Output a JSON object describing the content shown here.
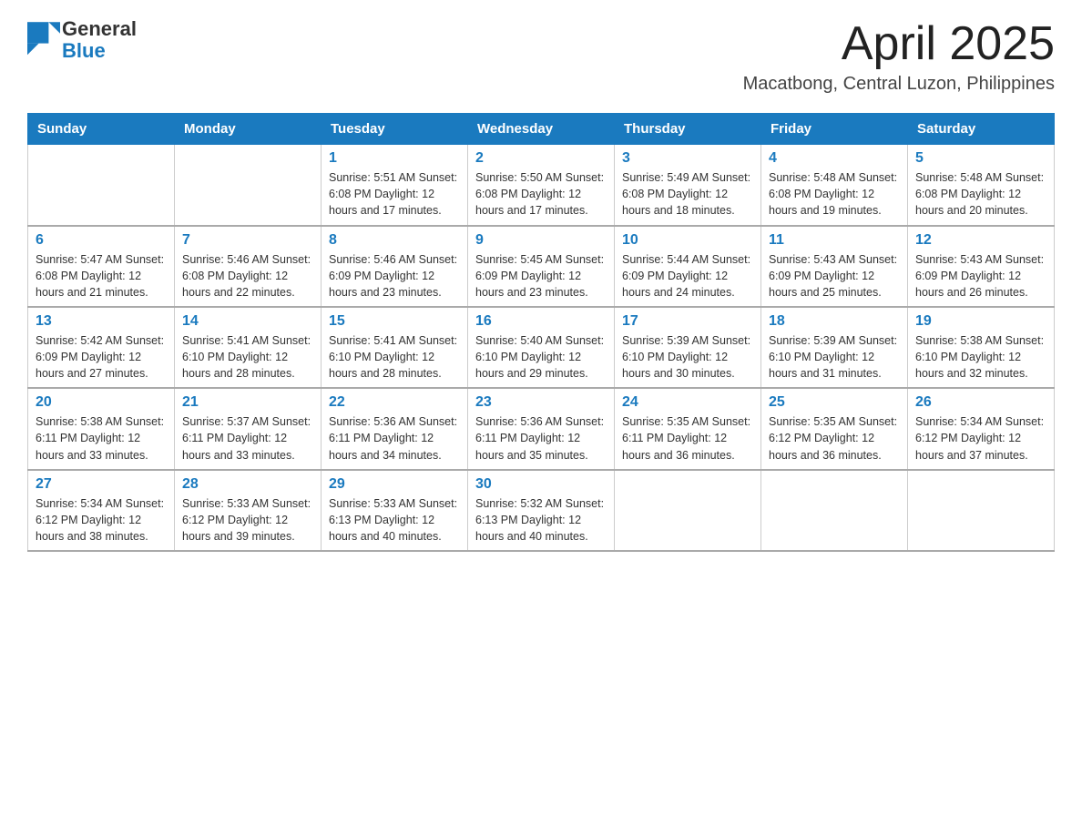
{
  "header": {
    "logo_text_general": "General",
    "logo_text_blue": "Blue",
    "month_title": "April 2025",
    "location": "Macatbong, Central Luzon, Philippines"
  },
  "calendar": {
    "days_of_week": [
      "Sunday",
      "Monday",
      "Tuesday",
      "Wednesday",
      "Thursday",
      "Friday",
      "Saturday"
    ],
    "weeks": [
      [
        {
          "day": "",
          "info": ""
        },
        {
          "day": "",
          "info": ""
        },
        {
          "day": "1",
          "info": "Sunrise: 5:51 AM\nSunset: 6:08 PM\nDaylight: 12 hours\nand 17 minutes."
        },
        {
          "day": "2",
          "info": "Sunrise: 5:50 AM\nSunset: 6:08 PM\nDaylight: 12 hours\nand 17 minutes."
        },
        {
          "day": "3",
          "info": "Sunrise: 5:49 AM\nSunset: 6:08 PM\nDaylight: 12 hours\nand 18 minutes."
        },
        {
          "day": "4",
          "info": "Sunrise: 5:48 AM\nSunset: 6:08 PM\nDaylight: 12 hours\nand 19 minutes."
        },
        {
          "day": "5",
          "info": "Sunrise: 5:48 AM\nSunset: 6:08 PM\nDaylight: 12 hours\nand 20 minutes."
        }
      ],
      [
        {
          "day": "6",
          "info": "Sunrise: 5:47 AM\nSunset: 6:08 PM\nDaylight: 12 hours\nand 21 minutes."
        },
        {
          "day": "7",
          "info": "Sunrise: 5:46 AM\nSunset: 6:08 PM\nDaylight: 12 hours\nand 22 minutes."
        },
        {
          "day": "8",
          "info": "Sunrise: 5:46 AM\nSunset: 6:09 PM\nDaylight: 12 hours\nand 23 minutes."
        },
        {
          "day": "9",
          "info": "Sunrise: 5:45 AM\nSunset: 6:09 PM\nDaylight: 12 hours\nand 23 minutes."
        },
        {
          "day": "10",
          "info": "Sunrise: 5:44 AM\nSunset: 6:09 PM\nDaylight: 12 hours\nand 24 minutes."
        },
        {
          "day": "11",
          "info": "Sunrise: 5:43 AM\nSunset: 6:09 PM\nDaylight: 12 hours\nand 25 minutes."
        },
        {
          "day": "12",
          "info": "Sunrise: 5:43 AM\nSunset: 6:09 PM\nDaylight: 12 hours\nand 26 minutes."
        }
      ],
      [
        {
          "day": "13",
          "info": "Sunrise: 5:42 AM\nSunset: 6:09 PM\nDaylight: 12 hours\nand 27 minutes."
        },
        {
          "day": "14",
          "info": "Sunrise: 5:41 AM\nSunset: 6:10 PM\nDaylight: 12 hours\nand 28 minutes."
        },
        {
          "day": "15",
          "info": "Sunrise: 5:41 AM\nSunset: 6:10 PM\nDaylight: 12 hours\nand 28 minutes."
        },
        {
          "day": "16",
          "info": "Sunrise: 5:40 AM\nSunset: 6:10 PM\nDaylight: 12 hours\nand 29 minutes."
        },
        {
          "day": "17",
          "info": "Sunrise: 5:39 AM\nSunset: 6:10 PM\nDaylight: 12 hours\nand 30 minutes."
        },
        {
          "day": "18",
          "info": "Sunrise: 5:39 AM\nSunset: 6:10 PM\nDaylight: 12 hours\nand 31 minutes."
        },
        {
          "day": "19",
          "info": "Sunrise: 5:38 AM\nSunset: 6:10 PM\nDaylight: 12 hours\nand 32 minutes."
        }
      ],
      [
        {
          "day": "20",
          "info": "Sunrise: 5:38 AM\nSunset: 6:11 PM\nDaylight: 12 hours\nand 33 minutes."
        },
        {
          "day": "21",
          "info": "Sunrise: 5:37 AM\nSunset: 6:11 PM\nDaylight: 12 hours\nand 33 minutes."
        },
        {
          "day": "22",
          "info": "Sunrise: 5:36 AM\nSunset: 6:11 PM\nDaylight: 12 hours\nand 34 minutes."
        },
        {
          "day": "23",
          "info": "Sunrise: 5:36 AM\nSunset: 6:11 PM\nDaylight: 12 hours\nand 35 minutes."
        },
        {
          "day": "24",
          "info": "Sunrise: 5:35 AM\nSunset: 6:11 PM\nDaylight: 12 hours\nand 36 minutes."
        },
        {
          "day": "25",
          "info": "Sunrise: 5:35 AM\nSunset: 6:12 PM\nDaylight: 12 hours\nand 36 minutes."
        },
        {
          "day": "26",
          "info": "Sunrise: 5:34 AM\nSunset: 6:12 PM\nDaylight: 12 hours\nand 37 minutes."
        }
      ],
      [
        {
          "day": "27",
          "info": "Sunrise: 5:34 AM\nSunset: 6:12 PM\nDaylight: 12 hours\nand 38 minutes."
        },
        {
          "day": "28",
          "info": "Sunrise: 5:33 AM\nSunset: 6:12 PM\nDaylight: 12 hours\nand 39 minutes."
        },
        {
          "day": "29",
          "info": "Sunrise: 5:33 AM\nSunset: 6:13 PM\nDaylight: 12 hours\nand 40 minutes."
        },
        {
          "day": "30",
          "info": "Sunrise: 5:32 AM\nSunset: 6:13 PM\nDaylight: 12 hours\nand 40 minutes."
        },
        {
          "day": "",
          "info": ""
        },
        {
          "day": "",
          "info": ""
        },
        {
          "day": "",
          "info": ""
        }
      ]
    ]
  }
}
